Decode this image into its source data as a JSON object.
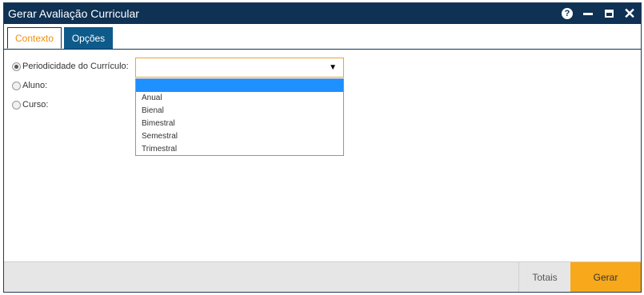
{
  "window": {
    "title": "Gerar Avaliação Curricular",
    "help_glyph": "?"
  },
  "tabs": [
    {
      "label": "Contexto",
      "active": true
    },
    {
      "label": "Opções",
      "active": false
    }
  ],
  "form": {
    "options": [
      {
        "label": "Periodicidade do Currículo:",
        "checked": true
      },
      {
        "label": "Aluno:",
        "checked": false
      },
      {
        "label": "Curso:",
        "checked": false
      }
    ],
    "select_value": "",
    "dropdown_options": [
      "",
      "Anual",
      "Bienal",
      "Bimestral",
      "Semestral",
      "Trimestral"
    ]
  },
  "footer": {
    "totais_label": "Totais",
    "gerar_label": "Gerar"
  },
  "colors": {
    "titlebar": "#0e3154",
    "accent": "#f7a81b",
    "active_tab_text": "#f0900f",
    "selection": "#1e90ff"
  }
}
